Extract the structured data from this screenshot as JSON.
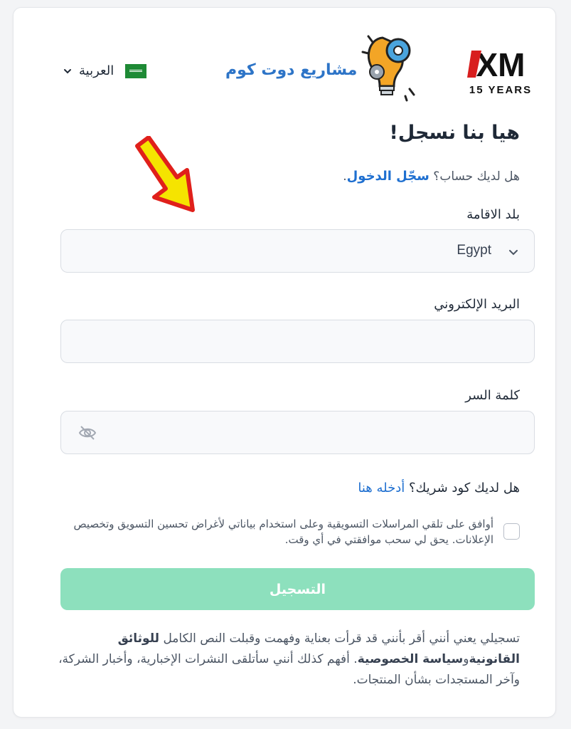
{
  "header": {
    "language_label": "العربية",
    "watermark_text": "مشاريع دوت كوم",
    "brand_wordmark": "XM",
    "brand_years": "15 YEARS"
  },
  "form": {
    "title": "هيا بنا نسجل!",
    "have_account_text": "هل لديك حساب؟",
    "login_link": "سجّل الدخول",
    "login_suffix": ".",
    "country_label": "بلد الاقامة",
    "country_value": "Egypt",
    "email_label": "البريد الإلكتروني",
    "email_value": "",
    "password_label": "كلمة السر",
    "password_value": "",
    "partner_question": "هل لديك كود شريك؟",
    "partner_link": "أدخله هنا",
    "consent_text": "أوافق على تلقي المراسلات التسويقية وعلى استخدام بياناتي لأغراض تحسين التسويق وتخصيص الإعلانات. يحق لي سحب موافقتي في أي وقت.",
    "consent_checked": false,
    "register_button": "التسجيل",
    "disclaimer_part1": "تسجيلي يعني أنني أقر بأنني قد قرأت بعناية وفهمت وقبلت النص الكامل",
    "disclaimer_legal": "للوثائق القانونية",
    "disclaimer_and": "و",
    "disclaimer_privacy": "سياسة الخصوصية",
    "disclaimer_part2": ". أفهم كذلك أنني سأتلقى النشرات الإخبارية، وأخبار الشركة، وآخر المستجدات بشأن المنتجات."
  },
  "colors": {
    "accent_link": "#1e6fd0",
    "register_button_bg": "#8de0bd",
    "arrow_fill": "#f5e400",
    "arrow_stroke": "#e0201b",
    "brand_red": "#d81e1e"
  },
  "icons": {
    "language_chevron": "chevron-down-icon",
    "flag": "saudi-flag-icon",
    "country_chevron": "chevron-down-icon",
    "password_toggle": "eye-off-icon",
    "watermark_logo": "lightbulb-gear-icon",
    "annotation": "arrow-icon"
  }
}
